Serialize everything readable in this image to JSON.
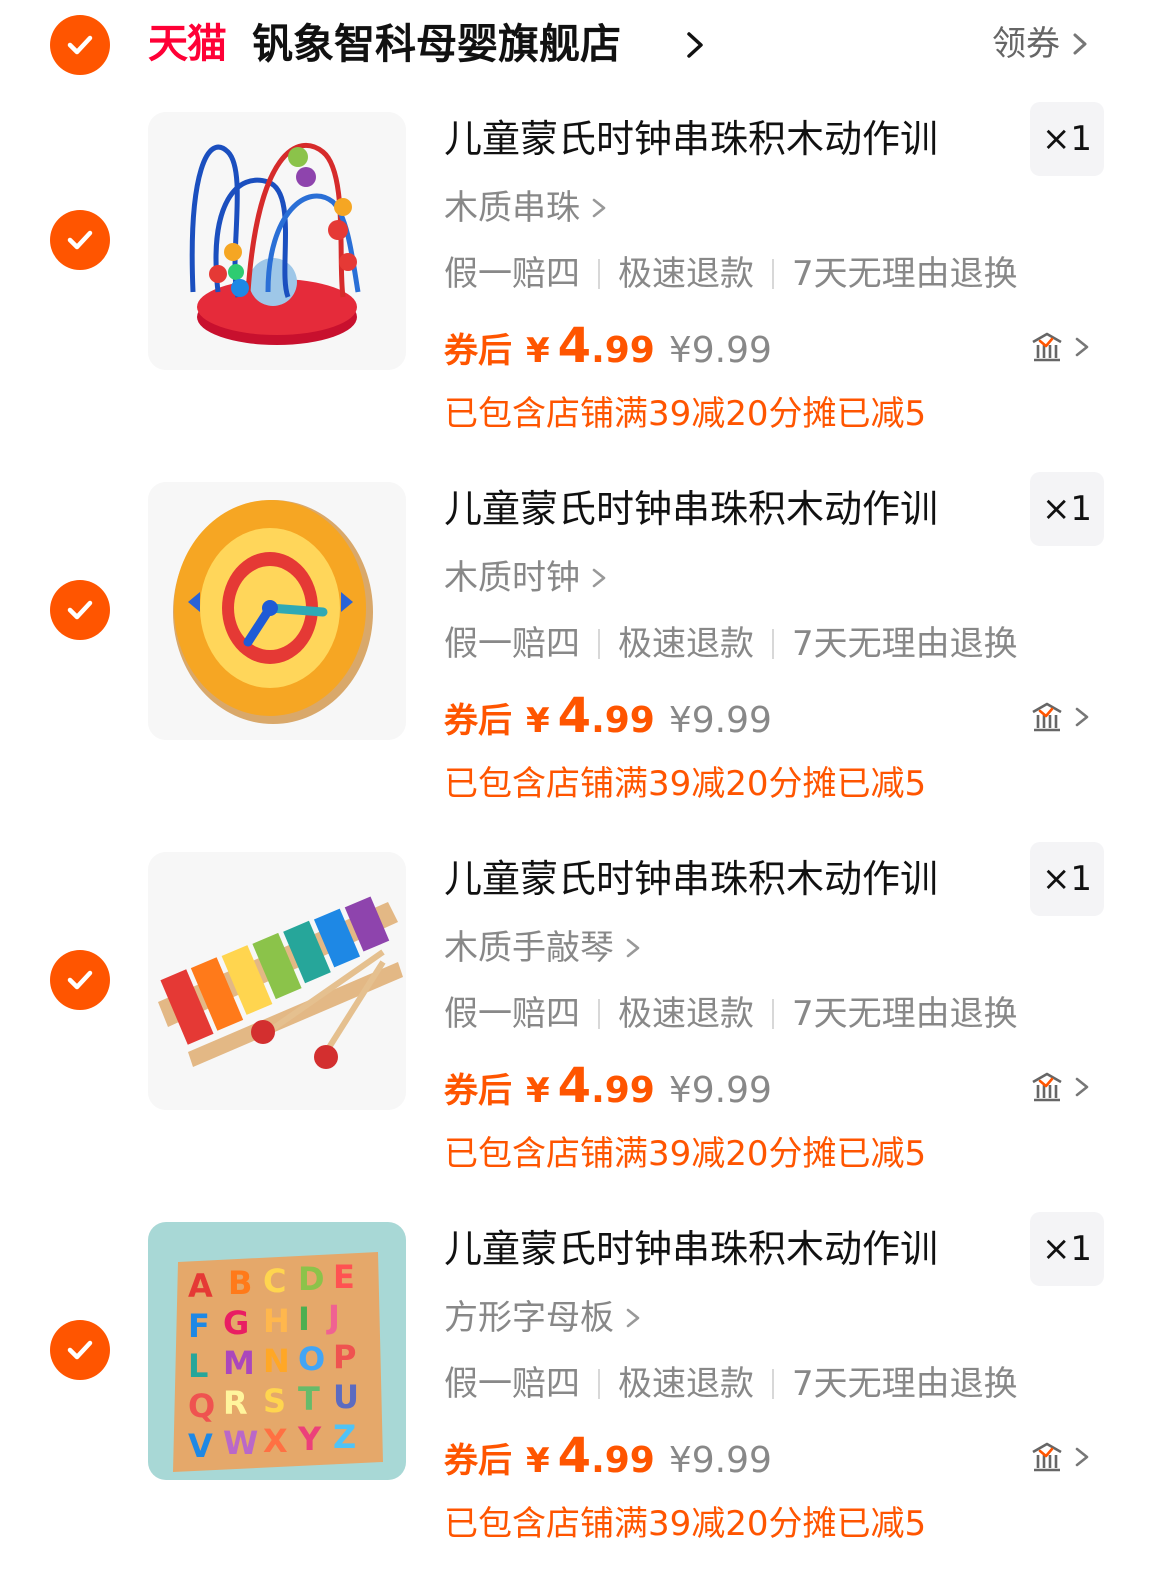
{
  "shop": {
    "logo_text": "天猫",
    "name": "钒象智科母婴旗舰店",
    "coupon_label": "领券",
    "selected": true
  },
  "colors": {
    "accent": "#ff5500",
    "tmall_red": "#ff0036",
    "muted_text": "#888888"
  },
  "items": [
    {
      "selected": true,
      "title": "儿童蒙氏时钟串珠积木动作训",
      "sku": "木质串珠",
      "quantity": "×1",
      "services": [
        "假一赔四",
        "极速退款",
        "7天无理由退换"
      ],
      "price_label": "券后",
      "currency": "¥",
      "price_int": "4",
      "price_dec": ".99",
      "original_price": "¥9.99",
      "discount_text": "已包含店铺满39减20分摊已减5",
      "thumb_icon": "bead-maze-toy-image"
    },
    {
      "selected": true,
      "title": "儿童蒙氏时钟串珠积木动作训",
      "sku": "木质时钟",
      "quantity": "×1",
      "services": [
        "假一赔四",
        "极速退款",
        "7天无理由退换"
      ],
      "price_label": "券后",
      "currency": "¥",
      "price_int": "4",
      "price_dec": ".99",
      "original_price": "¥9.99",
      "discount_text": "已包含店铺满39减20分摊已减5",
      "thumb_icon": "wooden-clock-toy-image"
    },
    {
      "selected": true,
      "title": "儿童蒙氏时钟串珠积木动作训",
      "sku": "木质手敲琴",
      "quantity": "×1",
      "services": [
        "假一赔四",
        "极速退款",
        "7天无理由退换"
      ],
      "price_label": "券后",
      "currency": "¥",
      "price_int": "4",
      "price_dec": ".99",
      "original_price": "¥9.99",
      "discount_text": "已包含店铺满39减20分摊已减5",
      "thumb_icon": "xylophone-toy-image"
    },
    {
      "selected": true,
      "title": "儿童蒙氏时钟串珠积木动作训",
      "sku": "方形字母板",
      "quantity": "×1",
      "services": [
        "假一赔四",
        "极速退款",
        "7天无理由退换"
      ],
      "price_label": "券后",
      "currency": "¥",
      "price_int": "4",
      "price_dec": ".99",
      "original_price": "¥9.99",
      "discount_text": "已包含店铺满39减20分摊已减5",
      "thumb_icon": "alphabet-puzzle-board-image"
    }
  ]
}
